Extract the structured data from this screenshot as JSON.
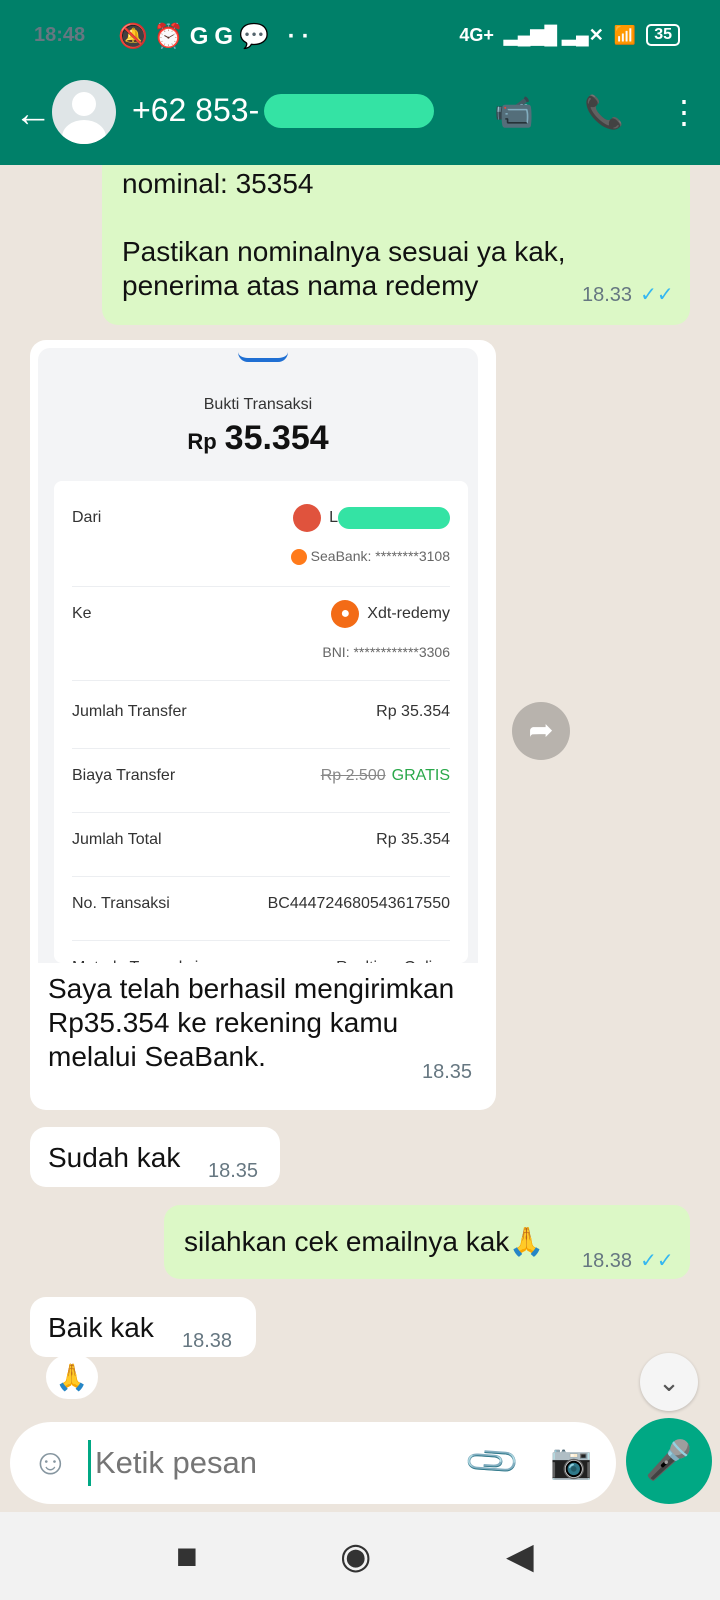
{
  "status_bar": {
    "time": "18:48",
    "left_icons": "🔕⏰GG💬 ··",
    "network": "4G+",
    "signal": "▂▄▆█ ▂▄✕",
    "wifi": "📶",
    "battery": "35"
  },
  "app_bar": {
    "contact": "+62 853-"
  },
  "messages": {
    "m1": {
      "line1": "nominal: 35354",
      "line2": "Pastikan nominalnya sesuai ya kak,",
      "line3": "penerima atas nama redemy",
      "time": "18.33",
      "ticks": "✓✓"
    },
    "receipt": {
      "title": "Bukti Transaksi",
      "amount_prefix": "Rp",
      "amount": "35.354",
      "dari_label": "Dari",
      "dari_initial": "L",
      "dari_bank": "SeaBank: ********3108",
      "ke_label": "Ke",
      "ke_name": "Xdt-redemy",
      "ke_bank": "BNI: ************3306",
      "jumlah_transfer_label": "Jumlah Transfer",
      "jumlah_transfer": "Rp 35.354",
      "biaya_label": "Biaya Transfer",
      "biaya_old": "Rp 2.500",
      "biaya_new": "GRATIS",
      "total_label": "Jumlah Total",
      "total": "Rp 35.354",
      "no_label": "No. Transaksi",
      "no_value": "BC444724680543617550",
      "metode_label": "Metode Transaksi",
      "metode_value": "Realtime Online",
      "caption1": "Saya telah berhasil mengirimkan",
      "caption2": "Rp35.354 ke rekening kamu",
      "caption3": "melalui SeaBank.",
      "time": "18.35"
    },
    "m3": {
      "text": "Sudah kak",
      "time": "18.35"
    },
    "m4": {
      "text": "silahkan cek emailnya kak🙏",
      "time": "18.38",
      "ticks": "✓✓"
    },
    "m5": {
      "text": "Baik kak",
      "time": "18.38",
      "reaction": "🙏"
    }
  },
  "input": {
    "placeholder": "Ketik pesan"
  },
  "icons": {
    "back": "←",
    "video": "📹",
    "call": "📞",
    "menu": "⋮",
    "forward": "➦",
    "scroll_down": "⌄",
    "emoji": "☺",
    "attach": "📎",
    "camera": "📷",
    "mic": "🎤",
    "nav_recent": "■",
    "nav_home": "◉",
    "nav_back": "◀"
  },
  "colors": {
    "header": "#008069",
    "outgoing": "#dcf8c6",
    "accent": "#00a884"
  }
}
